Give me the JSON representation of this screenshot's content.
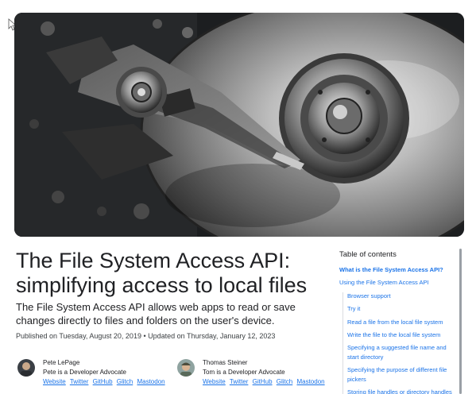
{
  "article": {
    "title": "The File System Access API: simplifying access to local files",
    "subtitle": "The File System Access API allows web apps to read or save changes directly to files and folders on the user's device.",
    "dates": "Published on Tuesday, August 20, 2019 • Updated on Thursday, January 12, 2023"
  },
  "authors": [
    {
      "name": "Pete LePage",
      "role": "Pete is a Developer Advocate",
      "links": [
        "Website",
        "Twitter",
        "GitHub",
        "Glitch",
        "Mastodon"
      ]
    },
    {
      "name": "Thomas Steiner",
      "role": "Tom is a Developer Advocate",
      "links": [
        "Website",
        "Twitter",
        "GitHub",
        "Glitch",
        "Mastodon"
      ]
    }
  ],
  "toc": {
    "title": "Table of contents",
    "items": [
      {
        "label": "What is the File System Access API?",
        "level": 1,
        "active": true
      },
      {
        "label": "Using the File System Access API",
        "level": 1,
        "active": false
      },
      {
        "label": "Browser support",
        "level": 2,
        "active": false
      },
      {
        "label": "Try it",
        "level": 2,
        "active": false
      },
      {
        "label": "Read a file from the local file system",
        "level": 2,
        "active": false
      },
      {
        "label": "Write the file to the local file system",
        "level": 2,
        "active": false
      },
      {
        "label": "Specifying a suggested file name and start directory",
        "level": 2,
        "active": false
      },
      {
        "label": "Specifying the purpose of different file pickers",
        "level": 2,
        "active": false
      },
      {
        "label": "Storing file handles or directory handles",
        "level": 2,
        "active": false
      }
    ]
  },
  "colors": {
    "link": "#1a73e8",
    "text": "#202124",
    "scrollbar": "#9aa0a6"
  },
  "icons": {
    "cursor": "arrow-cursor-icon"
  }
}
